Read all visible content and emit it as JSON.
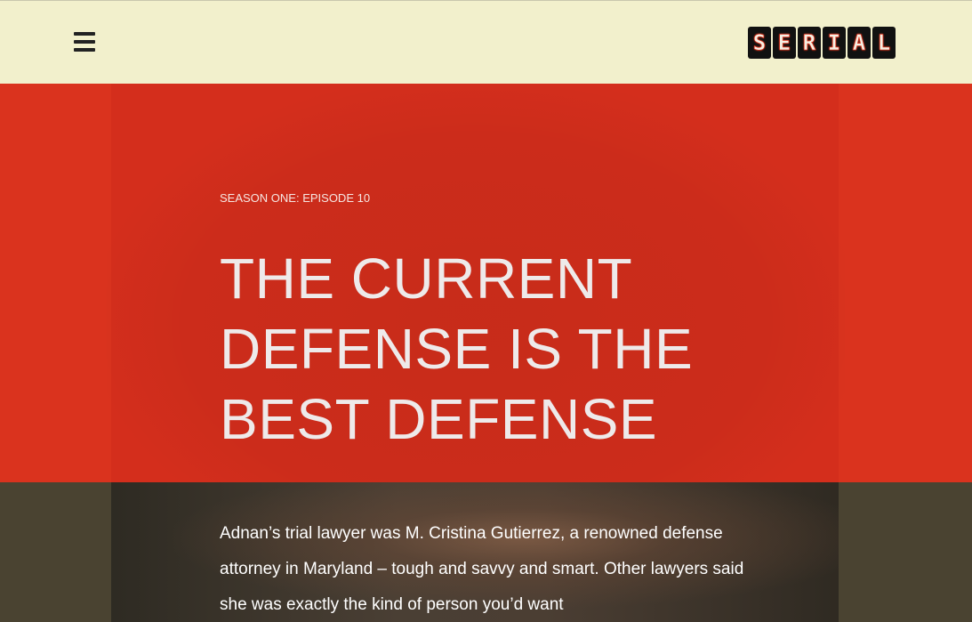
{
  "header": {
    "menu_icon": "hamburger-menu-icon",
    "logo_letters": [
      "S",
      "E",
      "R",
      "I",
      "A",
      "L"
    ],
    "colors": {
      "background": "#f2f0cc",
      "logo_tile": "#111111",
      "logo_glow": "#e8321c"
    }
  },
  "hero": {
    "eyebrow": "SEASON ONE: EPISODE 10",
    "title_lines": [
      "THE CURRENT",
      "DEFENSE IS THE",
      "BEST DEFENSE"
    ],
    "colors": {
      "background": "#d42e1c",
      "text": "#eeeaea"
    }
  },
  "article": {
    "intro": "Adnan’s trial lawyer was M. Cristina Gutierrez, a renowned defense attorney in Maryland – tough and savvy and smart. Other lawyers said she was exactly the kind of person you’d want",
    "colors": {
      "text": "#ffffff"
    }
  }
}
